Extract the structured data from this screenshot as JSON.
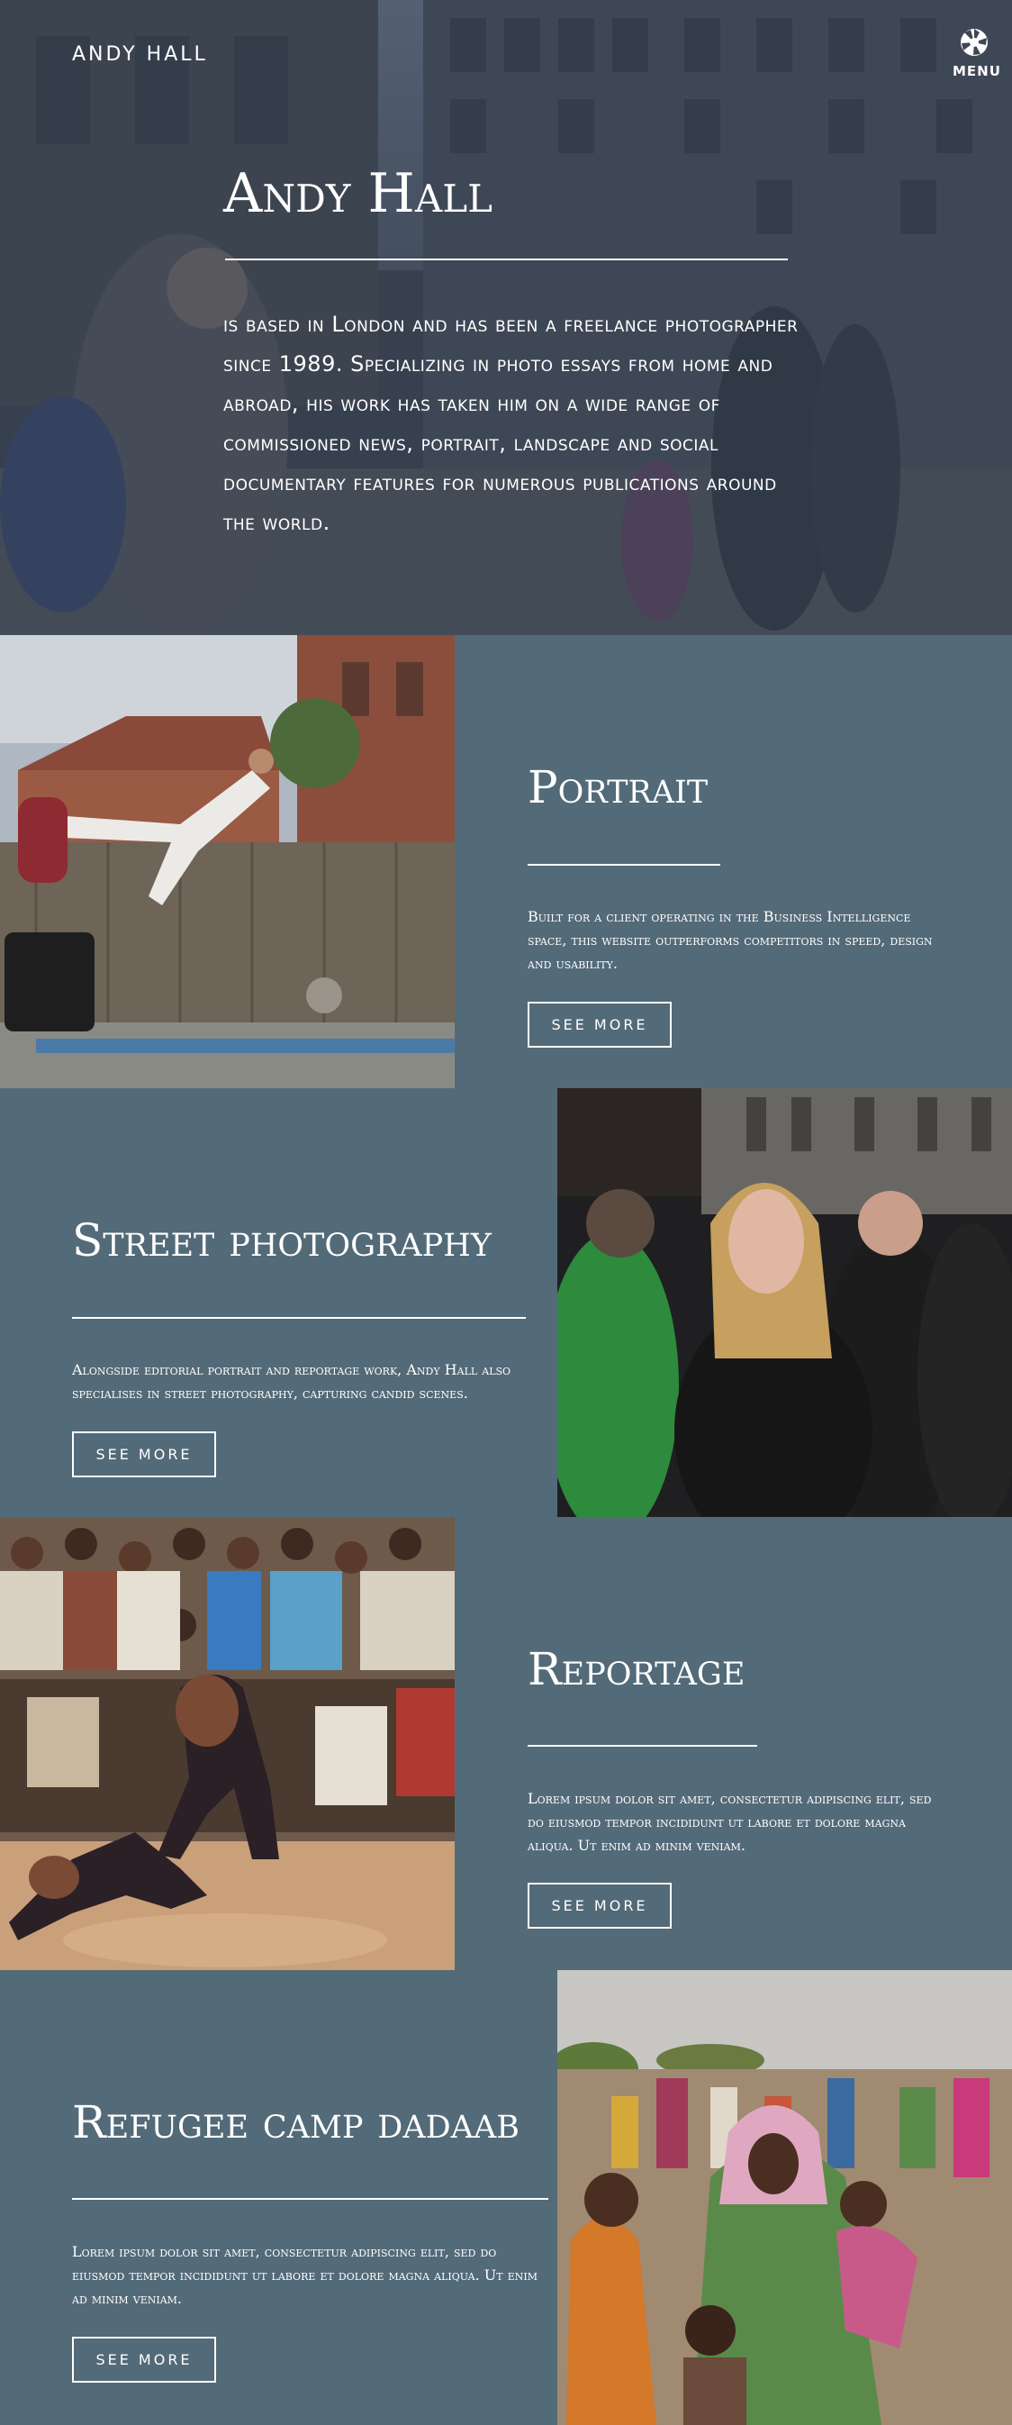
{
  "header": {
    "brand": "ANDY HALL",
    "menu_label": "MENU",
    "menu_icon": "aperture-icon"
  },
  "hero": {
    "title": "Andy Hall",
    "text": "is based in London and has been a freelance photographer since 1989. Specializing in photo essays from home and abroad, his work has taken him on a wide range of commissioned news, portrait, landscape and social documentary features for numerous publications around the world."
  },
  "sections": [
    {
      "title": "Portrait",
      "text": "Built for a client operating in the Business Intelligence space, this website outperforms competitors in speed, design and usability.",
      "button": "SEE MORE"
    },
    {
      "title": "Street photography",
      "text": "Alongside editorial portrait and reportage work, Andy Hall also specialises in street photography, capturing candid scenes.",
      "button": "SEE MORE"
    },
    {
      "title": "Reportage",
      "text": "Lorem ipsum dolor sit amet, consectetur adipiscing elit, sed do eiusmod tempor incididunt ut labore et dolore magna aliqua. Ut enim ad minim veniam.",
      "button": "SEE MORE"
    },
    {
      "title": "Refugee camp dadaab",
      "text": "Lorem ipsum dolor sit amet, consectetur adipiscing elit, sed do eiusmod tempor incididunt ut labore et dolore magna aliqua. Ut enim ad minim veniam.",
      "button": "SEE MORE"
    }
  ],
  "colors": {
    "section_bg": "#536a78",
    "text": "#ffffff"
  }
}
